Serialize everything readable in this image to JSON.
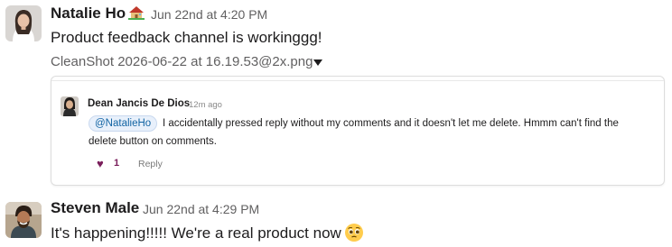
{
  "messages": [
    {
      "author": "Natalie Ho",
      "status_icon": "house-icon",
      "timestamp": "Jun 22nd at 4:20 PM",
      "text": "Product feedback channel is workinggg!",
      "file_name": "CleanShot 2026-06-22 at 16.19.53@2x.png",
      "preview": {
        "author": "Dean Jancis De Dios",
        "time": "12m ago",
        "mention": "@NatalieHo",
        "text_line1": "I accidentally pressed reply without my comments and it doesn't let me delete. Hmmm can't find the",
        "text_line2": "delete button on comments.",
        "likes": "1",
        "reply_label": "Reply"
      }
    },
    {
      "author": "Steven Male",
      "timestamp": "Jun 22nd at 4:29 PM",
      "text": "It's happening!!!!! We're a real product now",
      "emoji": "pleading-face-emoji"
    }
  ],
  "colors": {
    "text": "#1d1c1d",
    "muted": "#616061",
    "heart": "#7a1e5b",
    "mention": "#1264a3",
    "emoji": "#ffcc4d"
  }
}
